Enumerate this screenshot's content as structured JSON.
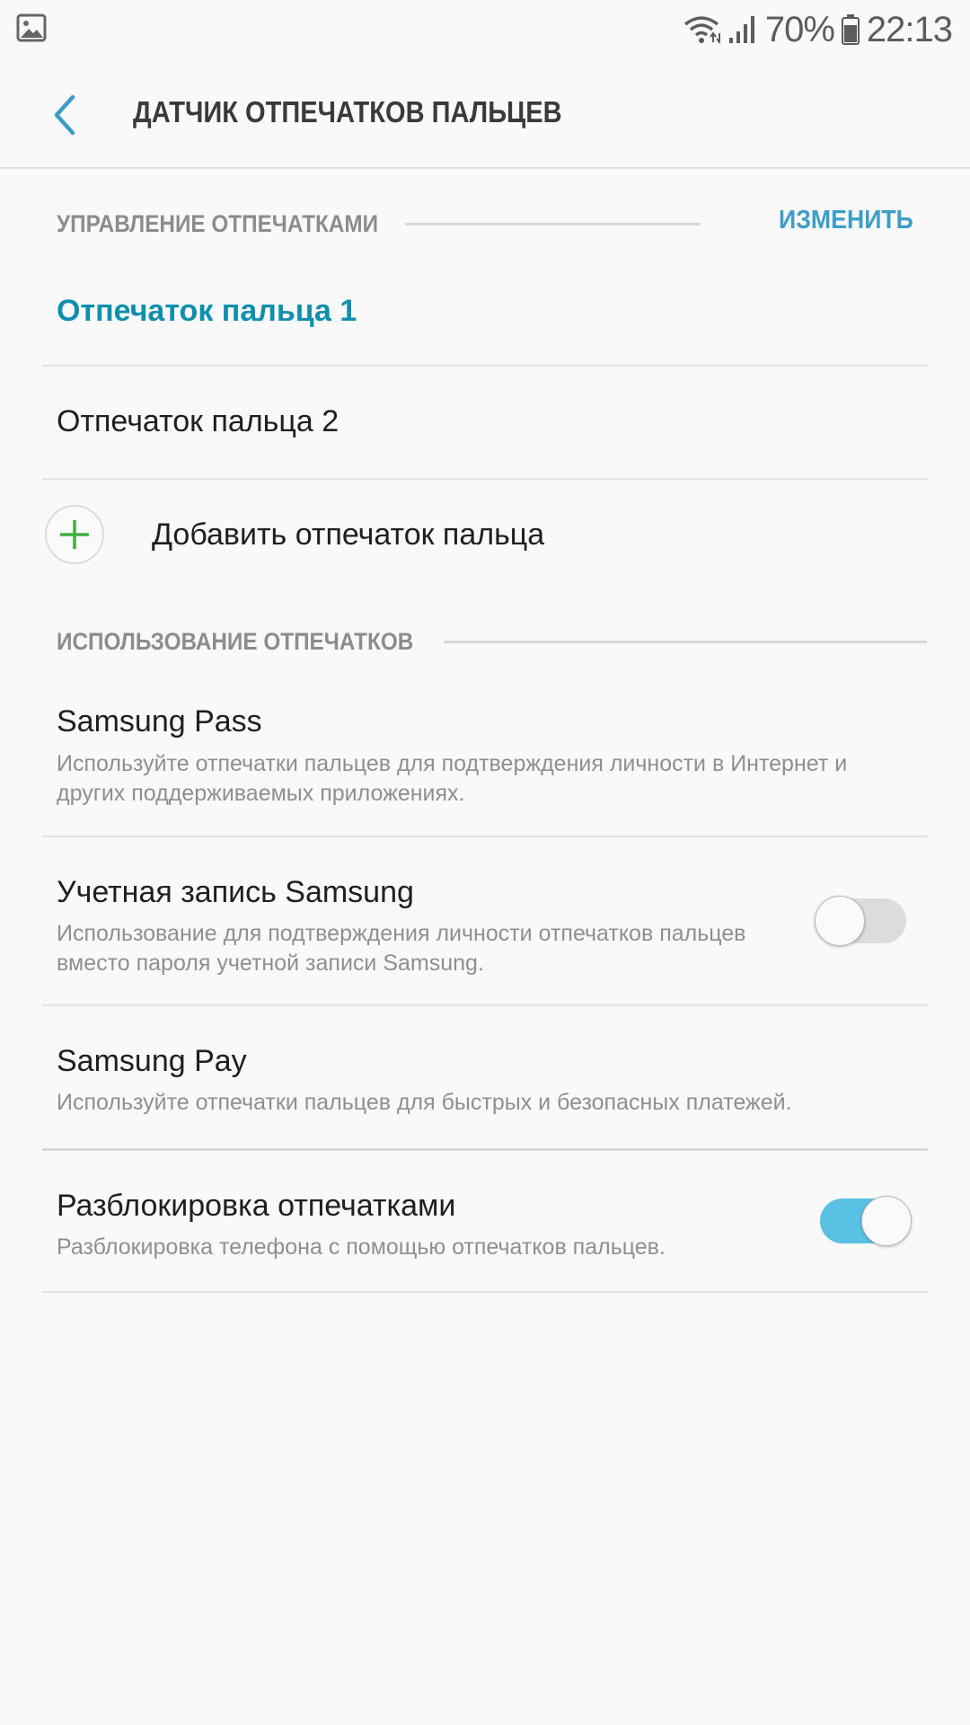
{
  "status_bar": {
    "battery_percent": "70%",
    "time": "22:13",
    "icons": [
      "gallery-icon",
      "wifi-icon",
      "signal-icon",
      "battery-icon"
    ]
  },
  "app_bar": {
    "title": "ДАТЧИК ОТПЕЧАТКОВ ПАЛЬЦЕВ",
    "back_icon": "chevron-left-icon"
  },
  "fingerprint_management": {
    "header": "УПРАВЛЕНИЕ ОТПЕЧАТКАМИ",
    "edit_label": "ИЗМЕНИТЬ",
    "items": [
      {
        "label": "Отпечаток пальца 1"
      },
      {
        "label": "Отпечаток пальца 2"
      }
    ],
    "add_label": "Добавить отпечаток пальца",
    "add_icon": "plus-icon"
  },
  "fingerprint_usage": {
    "header": "ИСПОЛЬЗОВАНИЕ ОТПЕЧАТКОВ",
    "items": [
      {
        "title": "Samsung Pass",
        "subtitle": "Используйте отпечатки пальцев для подтверждения личности в Интернет и других поддерживаемых приложениях."
      },
      {
        "title": "Учетная запись Samsung",
        "subtitle": "Использование для подтверждения личности отпечатков пальцев вместо пароля учетной записи Samsung.",
        "toggle": false
      },
      {
        "title": "Samsung Pay",
        "subtitle": "Используйте отпечатки пальцев для быстрых и безопасных платежей."
      },
      {
        "title": "Разблокировка отпечатками",
        "subtitle": "Разблокировка телефона с помощью отпечатков пальцев.",
        "toggle": true
      }
    ]
  },
  "colors": {
    "accent": "#0f8fae",
    "edit_link": "#3d9dc9",
    "toggle_on": "#5bc1e4",
    "plus": "#3cb043"
  }
}
